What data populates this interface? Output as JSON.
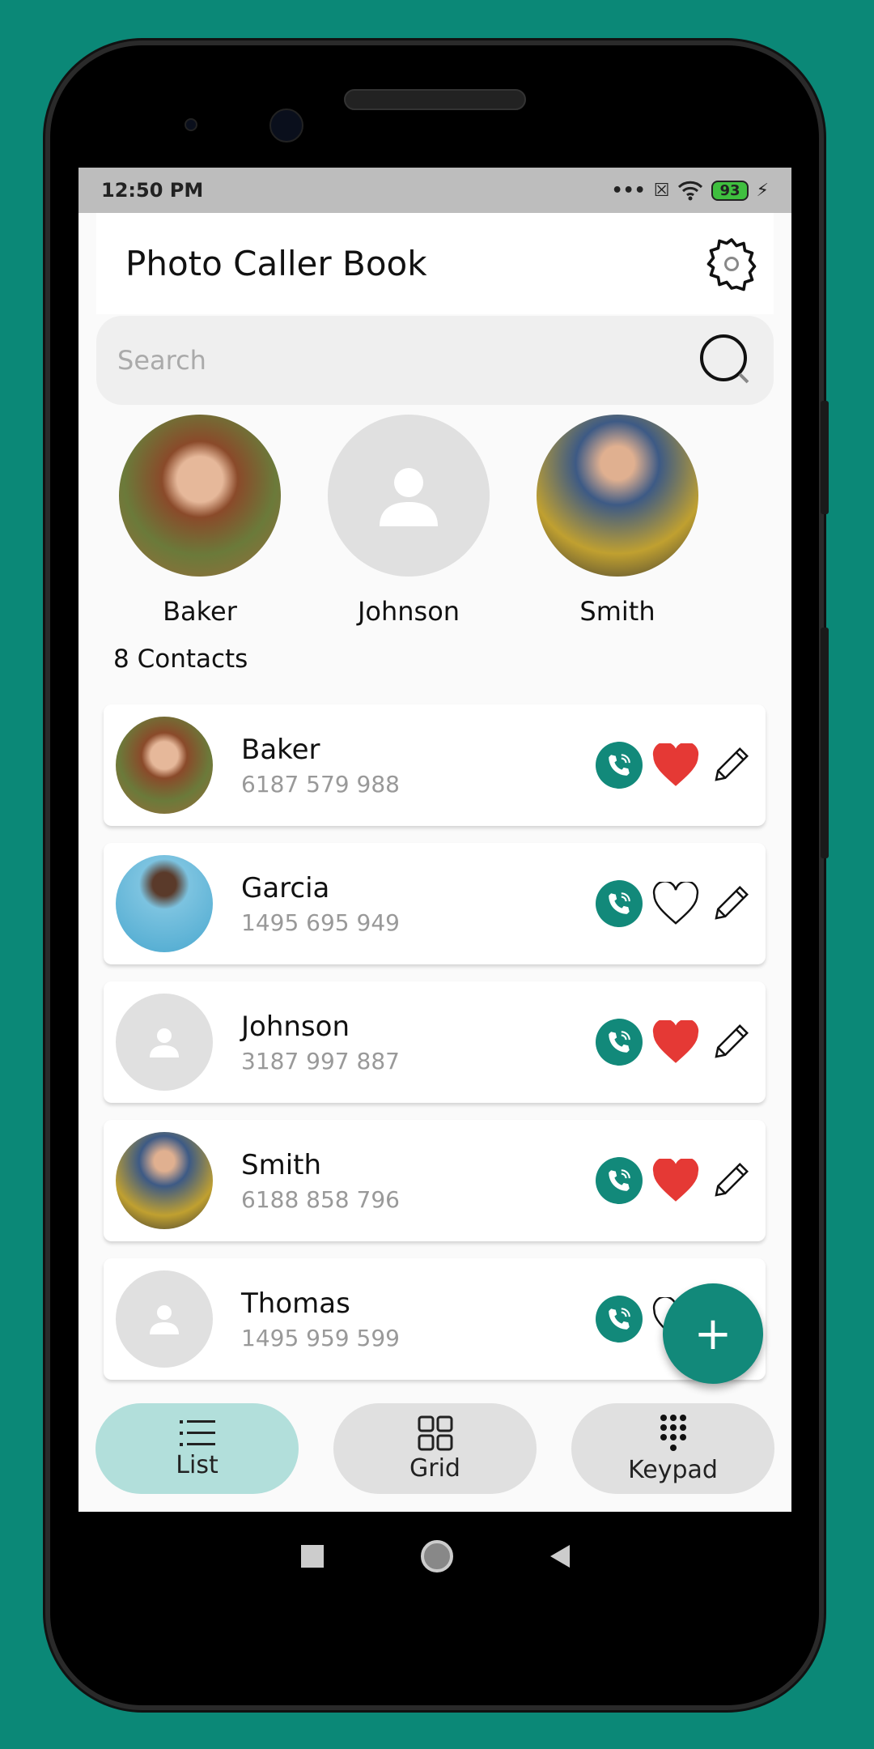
{
  "status": {
    "time": "12:50 PM",
    "battery": "93"
  },
  "header": {
    "title": "Photo Caller Book",
    "settings_icon": "gear-icon"
  },
  "search": {
    "placeholder": "Search"
  },
  "favorites": [
    {
      "name": "Baker",
      "photo": "woman-brown-hair"
    },
    {
      "name": "Johnson",
      "photo": "placeholder"
    },
    {
      "name": "Smith",
      "photo": "man-glasses"
    }
  ],
  "contacts_count": "8 Contacts",
  "contacts": [
    {
      "name": "Baker",
      "phone": "6187 579 988",
      "favorite": true,
      "photo": "woman-brown-hair"
    },
    {
      "name": "Garcia",
      "phone": "1495 695 949",
      "favorite": false,
      "photo": "woman-blue"
    },
    {
      "name": "Johnson",
      "phone": "3187 997 887",
      "favorite": true,
      "photo": "placeholder"
    },
    {
      "name": "Smith",
      "phone": "6188 858 796",
      "favorite": true,
      "photo": "man-glasses"
    },
    {
      "name": "Thomas",
      "phone": "1495 959 599",
      "favorite": false,
      "photo": "placeholder"
    }
  ],
  "fab": {
    "label": "+"
  },
  "bottom_nav": [
    {
      "label": "List",
      "active": true
    },
    {
      "label": "Grid",
      "active": false
    },
    {
      "label": "Keypad",
      "active": false
    }
  ],
  "colors": {
    "accent": "#12897a",
    "favorite": "#e53935",
    "active_tab": "#b2dfdb"
  }
}
